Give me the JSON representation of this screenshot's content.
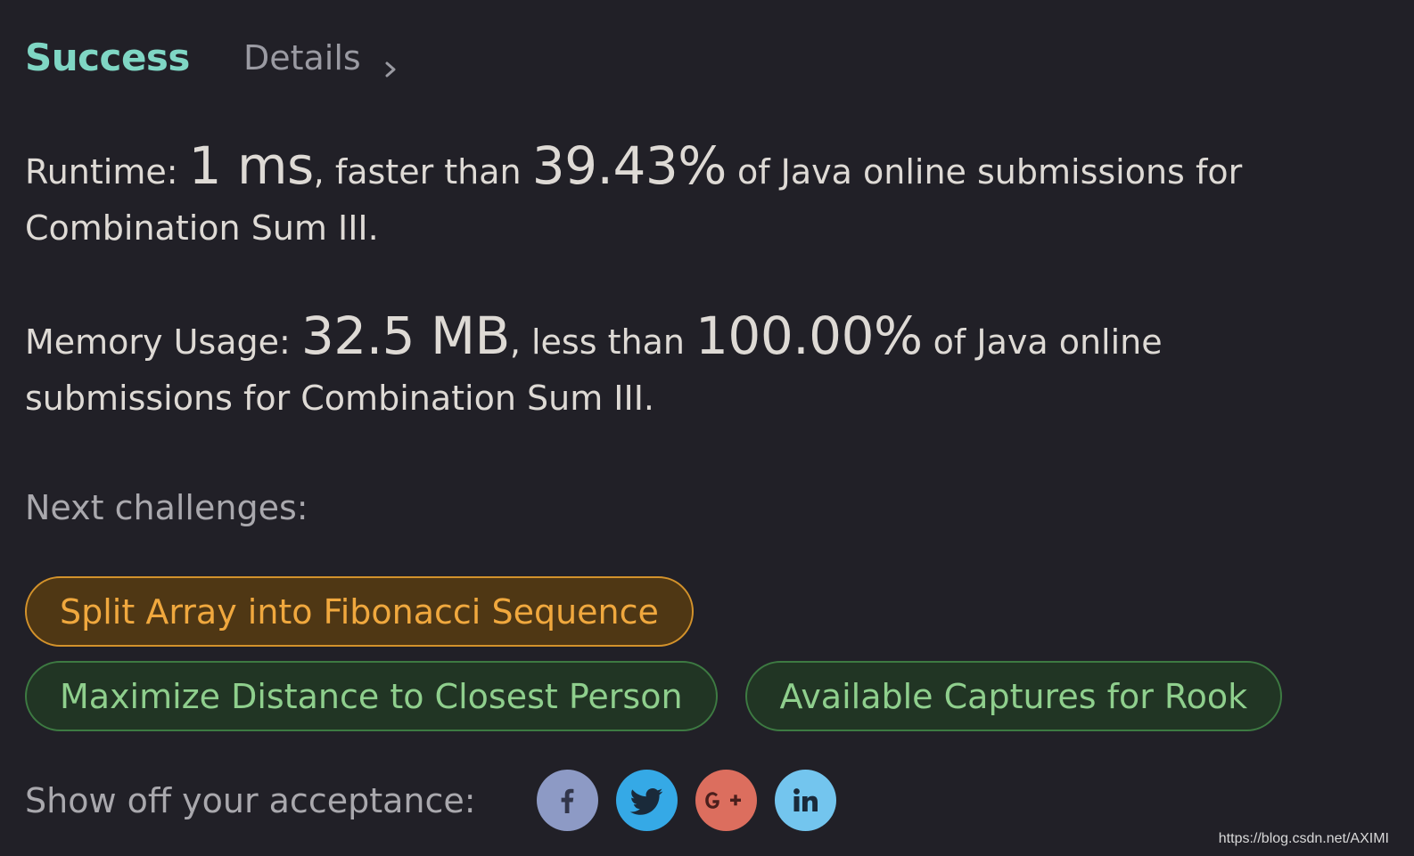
{
  "header": {
    "status": "Success",
    "details_label": "Details"
  },
  "runtime": {
    "label": "Runtime: ",
    "value": "1 ms",
    "comparison": ", faster than ",
    "percent": "39.43%",
    "suffix": " of Java online submissions for Combination Sum III."
  },
  "memory": {
    "label": "Memory Usage: ",
    "value": "32.5 MB",
    "comparison": ", less than ",
    "percent": "100.00%",
    "suffix": " of Java online submissions for Combination Sum III."
  },
  "next": {
    "label": "Next challenges:",
    "challenges": [
      {
        "title": "Split Array into Fibonacci Sequence",
        "difficulty": "medium"
      },
      {
        "title": "Maximize Distance to Closest Person",
        "difficulty": "easy"
      },
      {
        "title": "Available Captures for Rook",
        "difficulty": "easy"
      }
    ]
  },
  "share": {
    "label": "Show off your acceptance:",
    "networks": [
      {
        "icon": "facebook-icon",
        "color": "#8d9ac5"
      },
      {
        "icon": "twitter-icon",
        "color": "#35a9e6"
      },
      {
        "icon": "google-plus-icon",
        "color": "#dc6e5e"
      },
      {
        "icon": "linkedin-icon",
        "color": "#73c5ee"
      }
    ]
  },
  "colors": {
    "background": "#212027",
    "success": "#7fd6c4",
    "medium_text": "#f0a83e",
    "easy_text": "#8fcf8d"
  },
  "watermark": "https://blog.csdn.net/AXIMI"
}
